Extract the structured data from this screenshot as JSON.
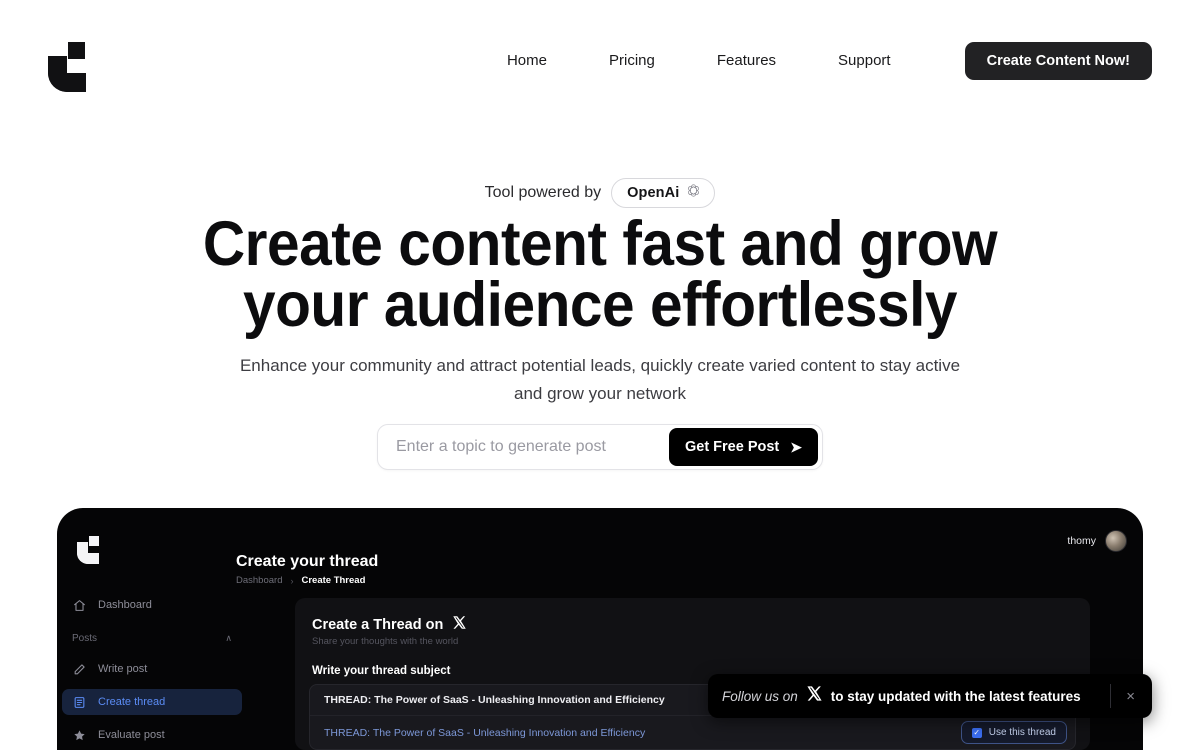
{
  "header": {
    "logo_name": "brand-logo",
    "nav": [
      {
        "label": "Home"
      },
      {
        "label": "Pricing"
      },
      {
        "label": "Features"
      },
      {
        "label": "Support"
      }
    ],
    "cta_label": "Create Content Now!"
  },
  "hero": {
    "powered_label": "Tool powered by",
    "powered_badge": "OpenAi",
    "headline_line1": "Create content fast and grow",
    "headline_line2": "your audience effortlessly",
    "subheading": "Enhance your community and attract potential leads, quickly create varied content to stay active and grow your network",
    "search_placeholder": "Enter a topic to generate post",
    "search_value": "",
    "search_button": "Get Free Post",
    "search_button_arrow": "➤"
  },
  "preview": {
    "username": "thomy",
    "page_title": "Create your thread",
    "breadcrumb": {
      "root": "Dashboard",
      "separator": "›",
      "current": "Create Thread"
    },
    "sidebar": {
      "dashboard": "Dashboard",
      "section_label": "Posts",
      "section_chevron": "∧",
      "items": [
        {
          "label": "Write post",
          "icon": "pencil-icon",
          "active": false
        },
        {
          "label": "Create thread",
          "icon": "document-icon",
          "active": true
        },
        {
          "label": "Evaluate post",
          "icon": "star-icon",
          "active": false
        }
      ]
    },
    "card": {
      "title": "Create a Thread on",
      "subtitle": "Share your thoughts with the world",
      "field_label": "Write your thread subject",
      "input_value": "THREAD: The Power of SaaS - Unleashing Innovation and Efficiency",
      "suggestion": "THREAD: The Power of SaaS - Unleashing Innovation and Efficiency",
      "use_button": "Use this thread",
      "checkbox_mark": "✓"
    }
  },
  "toast": {
    "lead": "Follow us on",
    "main": "to stay updated with the latest features",
    "close": "×"
  },
  "colors": {
    "accent_dark": "#222224",
    "button_black": "#000000",
    "preview_bg": "#050506",
    "active_blue": "#5b8cf5",
    "checkbox_blue": "#3b6ef0"
  }
}
